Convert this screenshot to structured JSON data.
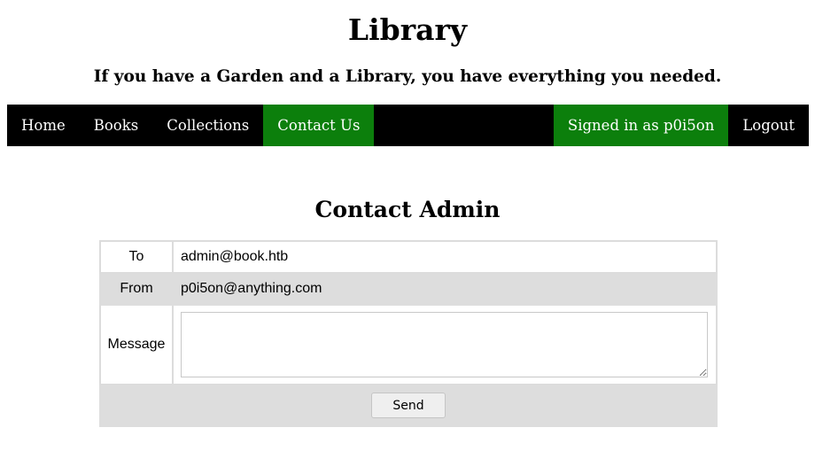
{
  "header": {
    "title": "Library",
    "tagline": "If you have a Garden and a Library, you have everything you needed."
  },
  "nav": {
    "items": [
      {
        "label": "Home",
        "active": false
      },
      {
        "label": "Books",
        "active": false
      },
      {
        "label": "Collections",
        "active": false
      },
      {
        "label": "Contact Us",
        "active": true
      }
    ],
    "signed_in_label": "Signed in as p0i5on",
    "logout_label": "Logout"
  },
  "contact": {
    "title": "Contact Admin",
    "to_label": "To",
    "to_value": "admin@book.htb",
    "from_label": "From",
    "from_value": "p0i5on@anything.com",
    "message_label": "Message",
    "message_value": "",
    "send_label": "Send"
  },
  "colors": {
    "nav_background": "#000000",
    "nav_active": "#0c7f0c",
    "table_stripe": "#dddddd"
  }
}
